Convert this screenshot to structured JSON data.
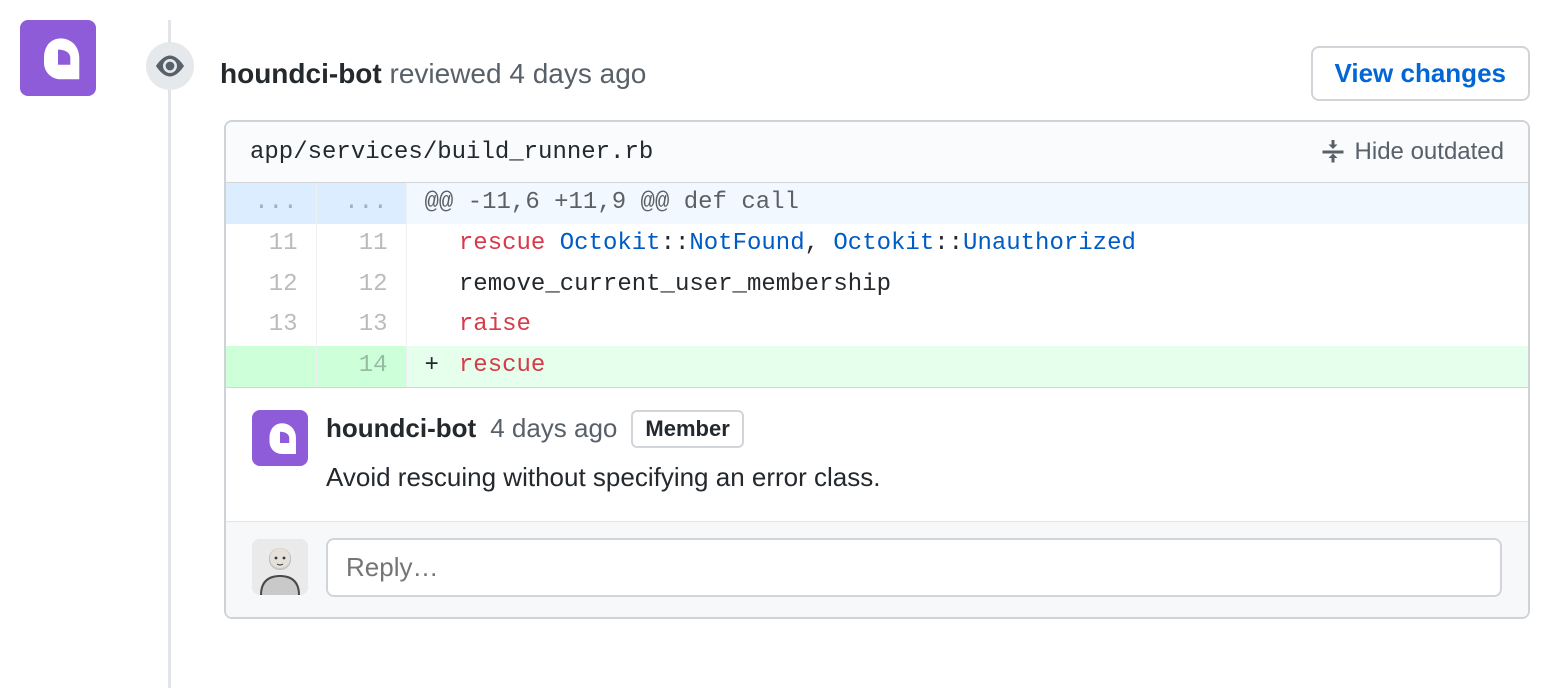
{
  "header": {
    "author": "houndci-bot",
    "action_text": " reviewed ",
    "time": "4 days ago",
    "view_changes_label": "View changes"
  },
  "file": {
    "path": "app/services/build_runner.rb",
    "hide_outdated_label": "Hide outdated"
  },
  "diff": {
    "hunk_header": "@@ -11,6 +11,9 @@ def call",
    "lines": [
      {
        "old": "11",
        "new": "11",
        "type": "context",
        "indent": "  ",
        "tokens": [
          {
            "t": "rescue",
            "c": "k-red"
          },
          {
            "t": " "
          },
          {
            "t": "Octokit",
            "c": "k-blue"
          },
          {
            "t": "::"
          },
          {
            "t": "NotFound",
            "c": "k-blue"
          },
          {
            "t": ", "
          },
          {
            "t": "Octokit",
            "c": "k-blue"
          },
          {
            "t": "::"
          },
          {
            "t": "Unauthorized",
            "c": "k-blue"
          }
        ]
      },
      {
        "old": "12",
        "new": "12",
        "type": "context",
        "indent": "    ",
        "tokens": [
          {
            "t": "remove_current_user_membership"
          }
        ]
      },
      {
        "old": "13",
        "new": "13",
        "type": "context",
        "indent": "    ",
        "tokens": [
          {
            "t": "raise",
            "c": "k-red"
          }
        ]
      },
      {
        "old": "",
        "new": "14",
        "type": "add",
        "indent": "  ",
        "tokens": [
          {
            "t": "rescue",
            "c": "k-red"
          }
        ]
      }
    ]
  },
  "comment": {
    "author": "houndci-bot",
    "time": "4 days ago",
    "badge": "Member",
    "body": "Avoid rescuing without specifying an error class."
  },
  "reply": {
    "placeholder": "Reply…"
  },
  "icons": {
    "hound": "hound-icon",
    "eye": "eye-icon",
    "fold": "fold-icon",
    "user": "user-avatar"
  }
}
